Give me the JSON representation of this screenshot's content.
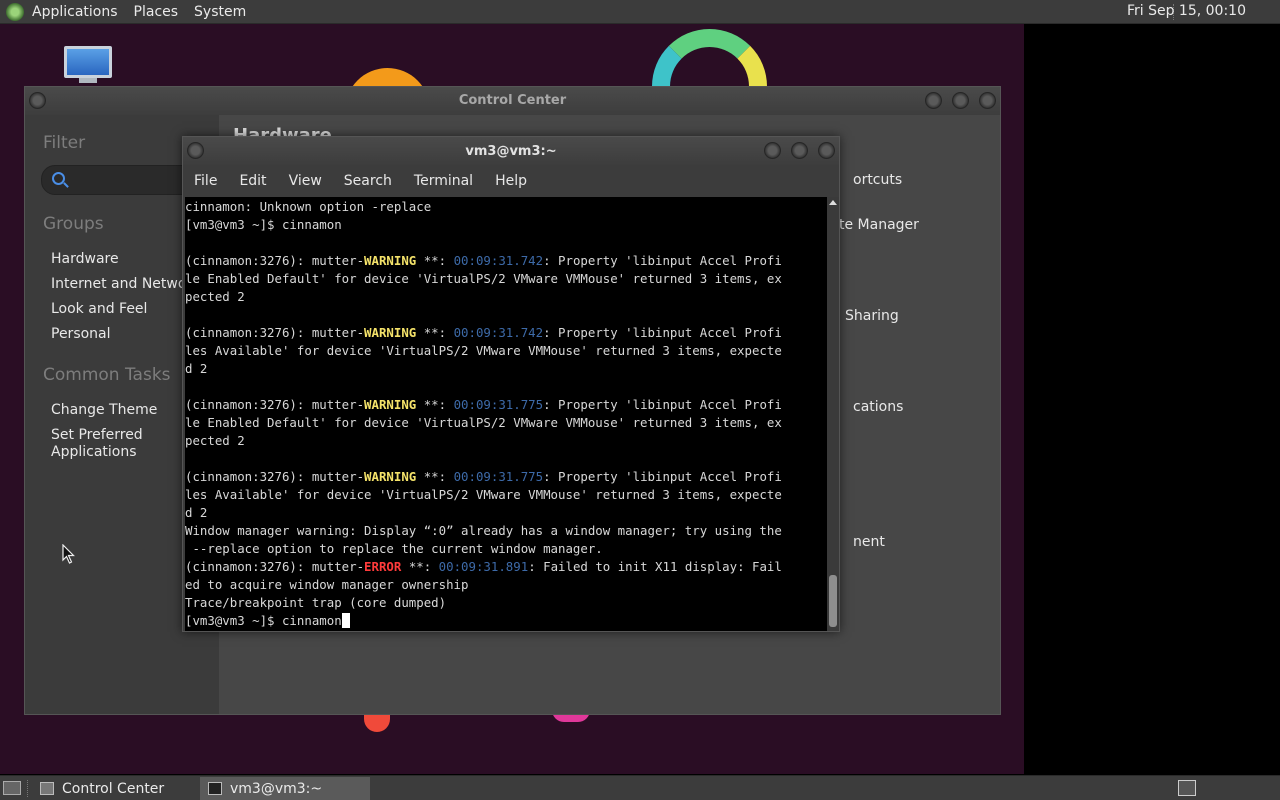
{
  "top_panel": {
    "menus": [
      "Applications",
      "Places",
      "System"
    ],
    "clock": "Fri Sep 15, 00:10"
  },
  "control_center": {
    "title": "Control Center",
    "filter_label": "Filter",
    "groups_label": "Groups",
    "groups": [
      "Hardware",
      "Internet and Network",
      "Look and Feel",
      "Personal"
    ],
    "common_tasks_label": "Common Tasks",
    "tasks": [
      "Change Theme",
      "Set Preferred Applications"
    ],
    "main_title": "Hardware",
    "right_items": [
      "ortcuts",
      "te Manager",
      "Sharing",
      "cations",
      "nent"
    ]
  },
  "terminal": {
    "title": "vm3@vm3:~",
    "menu": [
      "File",
      "Edit",
      "View",
      "Search",
      "Terminal",
      "Help"
    ],
    "lines": [
      {
        "segments": [
          {
            "t": "cinnamon: Unknown option -replace",
            "c": ""
          }
        ]
      },
      {
        "segments": [
          {
            "t": "[vm3@vm3 ~]$ cinnamon",
            "c": ""
          }
        ]
      },
      {
        "segments": [
          {
            "t": "",
            "c": ""
          }
        ]
      },
      {
        "segments": [
          {
            "t": "(cinnamon:3276): mutter-",
            "c": ""
          },
          {
            "t": "WARNING",
            "c": "warn"
          },
          {
            "t": " **: ",
            "c": ""
          },
          {
            "t": "00:09:31.742",
            "c": "ts"
          },
          {
            "t": ": Property 'libinput Accel Profi",
            "c": ""
          }
        ]
      },
      {
        "segments": [
          {
            "t": "le Enabled Default' for device 'VirtualPS/2 VMware VMMouse' returned 3 items, ex",
            "c": ""
          }
        ]
      },
      {
        "segments": [
          {
            "t": "pected 2",
            "c": ""
          }
        ]
      },
      {
        "segments": [
          {
            "t": "",
            "c": ""
          }
        ]
      },
      {
        "segments": [
          {
            "t": "(cinnamon:3276): mutter-",
            "c": ""
          },
          {
            "t": "WARNING",
            "c": "warn"
          },
          {
            "t": " **: ",
            "c": ""
          },
          {
            "t": "00:09:31.742",
            "c": "ts"
          },
          {
            "t": ": Property 'libinput Accel Profi",
            "c": ""
          }
        ]
      },
      {
        "segments": [
          {
            "t": "les Available' for device 'VirtualPS/2 VMware VMMouse' returned 3 items, expecte",
            "c": ""
          }
        ]
      },
      {
        "segments": [
          {
            "t": "d 2",
            "c": ""
          }
        ]
      },
      {
        "segments": [
          {
            "t": "",
            "c": ""
          }
        ]
      },
      {
        "segments": [
          {
            "t": "(cinnamon:3276): mutter-",
            "c": ""
          },
          {
            "t": "WARNING",
            "c": "warn"
          },
          {
            "t": " **: ",
            "c": ""
          },
          {
            "t": "00:09:31.775",
            "c": "ts"
          },
          {
            "t": ": Property 'libinput Accel Profi",
            "c": ""
          }
        ]
      },
      {
        "segments": [
          {
            "t": "le Enabled Default' for device 'VirtualPS/2 VMware VMMouse' returned 3 items, ex",
            "c": ""
          }
        ]
      },
      {
        "segments": [
          {
            "t": "pected 2",
            "c": ""
          }
        ]
      },
      {
        "segments": [
          {
            "t": "",
            "c": ""
          }
        ]
      },
      {
        "segments": [
          {
            "t": "(cinnamon:3276): mutter-",
            "c": ""
          },
          {
            "t": "WARNING",
            "c": "warn"
          },
          {
            "t": " **: ",
            "c": ""
          },
          {
            "t": "00:09:31.775",
            "c": "ts"
          },
          {
            "t": ": Property 'libinput Accel Profi",
            "c": ""
          }
        ]
      },
      {
        "segments": [
          {
            "t": "les Available' for device 'VirtualPS/2 VMware VMMouse' returned 3 items, expecte",
            "c": ""
          }
        ]
      },
      {
        "segments": [
          {
            "t": "d 2",
            "c": ""
          }
        ]
      },
      {
        "segments": [
          {
            "t": "Window manager warning: Display “:0” already has a window manager; try using the",
            "c": ""
          }
        ]
      },
      {
        "segments": [
          {
            "t": " --replace option to replace the current window manager.",
            "c": ""
          }
        ]
      },
      {
        "segments": [
          {
            "t": "(cinnamon:3276): mutter-",
            "c": ""
          },
          {
            "t": "ERROR",
            "c": "err"
          },
          {
            "t": " **: ",
            "c": ""
          },
          {
            "t": "00:09:31.891",
            "c": "ts"
          },
          {
            "t": ": Failed to init X11 display: Fail",
            "c": ""
          }
        ]
      },
      {
        "segments": [
          {
            "t": "ed to acquire window manager ownership",
            "c": ""
          }
        ]
      },
      {
        "segments": [
          {
            "t": "Trace/breakpoint trap (core dumped)",
            "c": ""
          }
        ]
      }
    ],
    "prompt": "[vm3@vm3 ~]$ cinnamon"
  },
  "taskbar": {
    "tasks": [
      "Control Center",
      "vm3@vm3:~"
    ]
  },
  "colors": {
    "warning": "#f5e36a",
    "error": "#ff3b3b",
    "timestamp": "#3d6aa8",
    "desktop_bg": "#2a0d24"
  }
}
